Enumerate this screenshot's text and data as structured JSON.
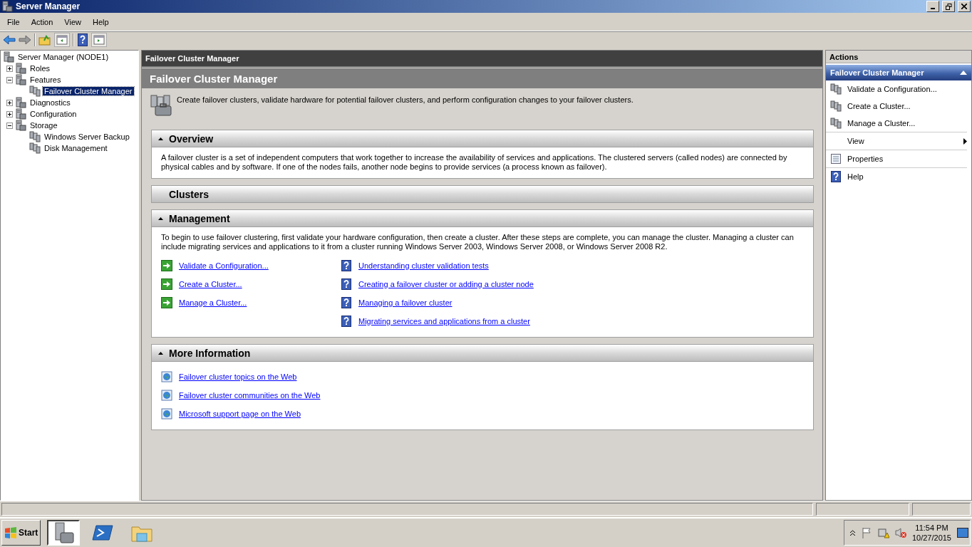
{
  "window": {
    "title": "Server Manager"
  },
  "menu": [
    {
      "label": "File"
    },
    {
      "label": "Action"
    },
    {
      "label": "View"
    },
    {
      "label": "Help"
    }
  ],
  "tree": [
    {
      "label": "Server Manager (NODE1)",
      "selected": false,
      "children": [
        {
          "label": "Roles",
          "expanded": false,
          "selected": false
        },
        {
          "label": "Features",
          "expanded": true,
          "selected": false,
          "children": [
            {
              "label": "Failover Cluster Manager",
              "selected": true
            }
          ]
        },
        {
          "label": "Diagnostics",
          "expanded": false,
          "selected": false
        },
        {
          "label": "Configuration",
          "expanded": false,
          "selected": false
        },
        {
          "label": "Storage",
          "expanded": true,
          "selected": false,
          "children": [
            {
              "label": "Windows Server Backup",
              "selected": false
            },
            {
              "label": "Disk Management",
              "selected": false
            }
          ]
        }
      ]
    }
  ],
  "content": {
    "header": "Failover Cluster Manager",
    "title": "Failover Cluster Manager",
    "description": "Create failover clusters, validate hardware for potential failover clusters, and perform configuration changes to your failover clusters.",
    "sections": [
      {
        "title": "Overview",
        "expanded": true,
        "text": "A failover cluster is a set of independent computers that work together to increase the availability of services and applications. The clustered servers (called nodes) are connected by physical cables and by software. If one of the nodes fails, another node begins to provide services (a process known as failover)."
      },
      {
        "title": "Clusters",
        "expanded": false
      },
      {
        "title": "Management",
        "expanded": true,
        "text": "To begin to use failover clustering, first validate your hardware configuration, then create a cluster.  After these steps are complete, you can manage the cluster.  Managing a cluster can include migrating services and applications to it from a cluster running Windows Server 2003, Windows Server 2008, or Windows Server 2008 R2.",
        "links": [
          {
            "label": "Validate a Configuration...",
            "kind": "action"
          },
          {
            "label": "Create a Cluster...",
            "kind": "action"
          },
          {
            "label": "Manage a Cluster...",
            "kind": "action"
          },
          {
            "label": "Understanding cluster validation tests",
            "kind": "help"
          },
          {
            "label": "Creating a failover cluster or adding a cluster node",
            "kind": "help"
          },
          {
            "label": "Managing a failover cluster",
            "kind": "help"
          },
          {
            "label": "Migrating services and applications from a cluster",
            "kind": "help"
          }
        ]
      },
      {
        "title": "More Information",
        "expanded": true,
        "links": [
          {
            "label": "Failover cluster topics on the Web",
            "kind": "web"
          },
          {
            "label": "Failover cluster communities on the Web",
            "kind": "web"
          },
          {
            "label": "Microsoft support page on the Web",
            "kind": "web"
          }
        ]
      }
    ]
  },
  "actions": {
    "title": "Actions",
    "group": {
      "title": "Failover Cluster Manager",
      "expanded": true
    },
    "items": [
      {
        "label": "Validate a Configuration...",
        "kind": "validate"
      },
      {
        "label": "Create a Cluster...",
        "kind": "create"
      },
      {
        "label": "Manage a Cluster...",
        "kind": "manage"
      },
      {
        "label": "View",
        "kind": "submenu"
      },
      {
        "label": "Properties",
        "kind": "properties"
      },
      {
        "label": "Help",
        "kind": "help"
      }
    ]
  },
  "taskbar": {
    "start": "Start",
    "items": [
      {
        "kind": "server",
        "selected": true
      },
      {
        "kind": "shell",
        "selected": false
      },
      {
        "kind": "folder",
        "selected": false
      }
    ],
    "time": "11:54 PM",
    "date": "10/27/2015"
  }
}
